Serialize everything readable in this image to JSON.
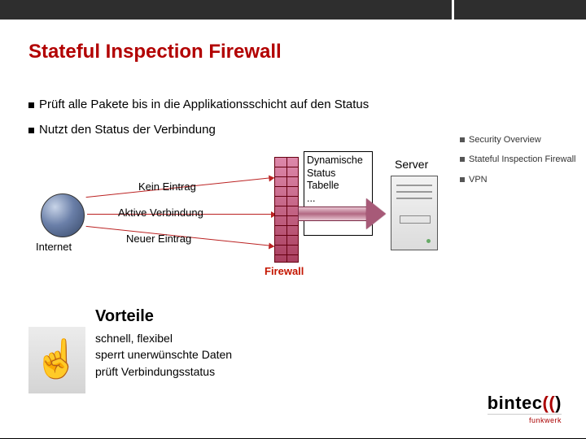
{
  "title": "Stateful Inspection Firewall",
  "bullets": [
    "Prüft alle Pakete bis in die Applikationsschicht auf den Status",
    "Nutzt den Status der Verbindung"
  ],
  "sidebar": {
    "items": [
      {
        "label": "Security Overview"
      },
      {
        "label": "Stateful Inspection Firewall"
      },
      {
        "label": "VPN"
      }
    ]
  },
  "diagram": {
    "internet": "Internet",
    "no_entry": "Kein Eintrag",
    "active_conn": "Aktive Verbindung",
    "new_entry": "Neuer Eintrag",
    "firewall": "Firewall",
    "status_table": "Dynamische Status Tabelle\n...\n...",
    "server": "Server"
  },
  "advantages": {
    "title": "Vorteile",
    "items": [
      "schnell, flexibel",
      "sperrt unerwünschte Daten",
      "prüft Verbindungsstatus"
    ]
  },
  "brand": {
    "name_a": "bintec",
    "paren": "((",
    "close": ")",
    "sub": "funkwerk"
  },
  "colors": {
    "accent": "#b20000"
  }
}
